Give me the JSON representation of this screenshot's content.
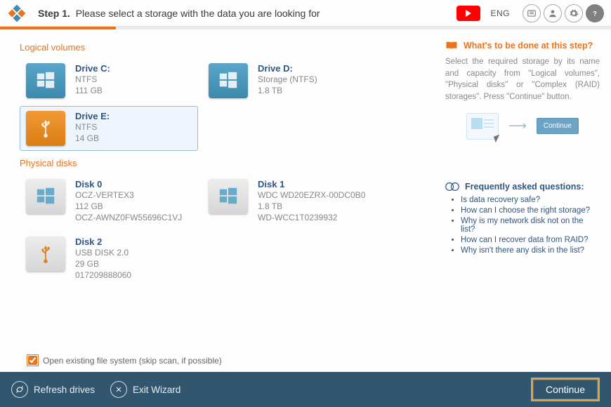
{
  "header": {
    "step_prefix": "Step 1.",
    "step_text": "Please select a storage with the data you are looking for",
    "lang": "ENG"
  },
  "sections": {
    "logical_title": "Logical volumes",
    "physical_title": "Physical disks"
  },
  "logical": [
    {
      "name": "Drive C:",
      "fs": "NTFS",
      "size": "111 GB",
      "variant": "blue",
      "selected": false
    },
    {
      "name": "Drive D:",
      "fs": "Storage (NTFS)",
      "size": "1.8 TB",
      "variant": "blue",
      "selected": false
    },
    {
      "name": "Drive E:",
      "fs": "NTFS",
      "size": "14 GB",
      "variant": "orange",
      "selected": true
    }
  ],
  "physical": [
    {
      "name": "Disk 0",
      "model": "OCZ-VERTEX3",
      "size": "112 GB",
      "serial": "OCZ-AWNZ0FW55696C1VJ",
      "variant": "gray"
    },
    {
      "name": "Disk 1",
      "model": "WDC WD20EZRX-00DC0B0",
      "size": "1.8 TB",
      "serial": "WD-WCC1T0239932",
      "variant": "gray"
    },
    {
      "name": "Disk 2",
      "model": "USB DISK 2.0",
      "size": "29 GB",
      "serial": "017209888060",
      "variant": "usb"
    }
  ],
  "checkbox_label": "Open existing file system (skip scan, if possible)",
  "hint": {
    "title": "What's to be done at this step?",
    "text": "Select the required storage by its name and capacity from \"Logical volumes\", \"Physical disks\" or \"Complex (RAID) storages\". Press \"Continue\" button.",
    "mini_continue": "Continue"
  },
  "faq": {
    "title": "Frequently asked questions:",
    "items": [
      "Is data recovery safe?",
      "How can I choose the right storage?",
      "Why is my network disk not on the list?",
      "How can I recover data from RAID?",
      "Why isn't there any disk in the list?"
    ]
  },
  "footer": {
    "refresh": "Refresh drives",
    "exit": "Exit Wizard",
    "continue": "Continue"
  }
}
